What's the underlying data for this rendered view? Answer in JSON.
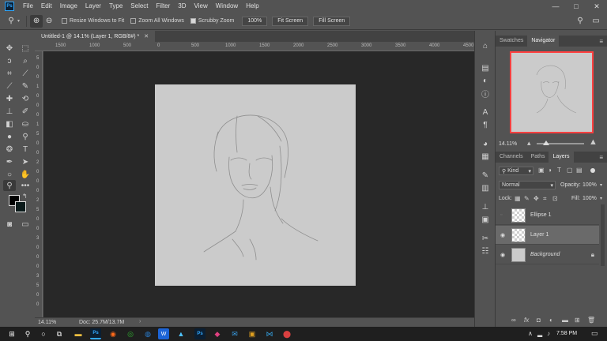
{
  "menu": {
    "items": [
      "File",
      "Edit",
      "Image",
      "Layer",
      "Type",
      "Select",
      "Filter",
      "3D",
      "View",
      "Window",
      "Help"
    ],
    "logo": "Ps"
  },
  "options": {
    "resize_label": "Resize Windows to Fit",
    "zoom_all_label": "Zoom All Windows",
    "scrubby_label": "Scrubby Zoom",
    "zoom_pct": "100%",
    "fit_label": "Fit Screen",
    "fill_label": "Fill Screen"
  },
  "document": {
    "tab_title": "Untitled-1 @ 14.1% (Layer 1, RGB/8#) *",
    "ruler_h": [
      "1500",
      "1000",
      "500",
      "0",
      "500",
      "1000",
      "1500",
      "2000",
      "2500",
      "3000",
      "3500",
      "4000",
      "4500"
    ],
    "ruler_v": [
      "5",
      "0",
      "0",
      "1",
      "0",
      "0",
      "0",
      "1",
      "5",
      "0",
      "0",
      "2",
      "0",
      "0",
      "0",
      "2",
      "5",
      "0",
      "0",
      "3",
      "0",
      "0",
      "0",
      "3",
      "5",
      "0",
      "0"
    ],
    "zoom": "14.11%",
    "doc_info": "Doc: 25.7M/13.7M"
  },
  "navigator": {
    "tabs": [
      "Swatches",
      "Navigator"
    ],
    "zoom": "14.11%",
    "zoom_fraction": 0.2
  },
  "layers_panel": {
    "tabs": [
      "Channels",
      "Paths",
      "Layers"
    ],
    "filter": "Kind",
    "blend_mode": "Normal",
    "opacity_label": "Opacity:",
    "opacity": "100%",
    "lock_label": "Lock:",
    "fill_label": "Fill:",
    "fill": "100%",
    "layers": [
      {
        "name": "Ellipse 1",
        "visible": false,
        "selected": false
      },
      {
        "name": "Layer 1",
        "visible": true,
        "selected": true
      },
      {
        "name": "Background",
        "visible": true,
        "selected": false,
        "locked": true
      }
    ]
  },
  "taskbar": {
    "time": "7:58 PM"
  },
  "colors": {
    "app_bg": "#535353",
    "workspace": "#282828",
    "canvas": "#cbcbcb",
    "accent": "#31a8ff",
    "nav_frame": "#ff4040"
  }
}
